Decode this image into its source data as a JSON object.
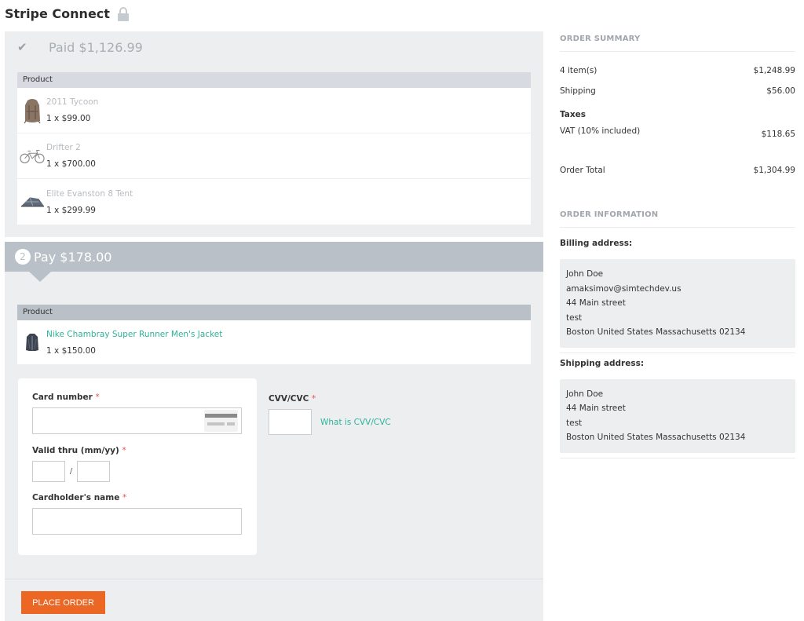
{
  "page": {
    "title": "Stripe Connect",
    "title_icon": "lock-icon"
  },
  "paid_section": {
    "icon": "check-icon",
    "title": "Paid $1,126.99",
    "product_header": "Product",
    "products": [
      {
        "name": "2011 Tycoon",
        "qty_price": "1 x $99.00",
        "thumb": "backpack"
      },
      {
        "name": "Drifter 2",
        "qty_price": "1 x $700.00",
        "thumb": "bicycle"
      },
      {
        "name": "Elite Evanston 8 Tent",
        "qty_price": "1 x $299.99",
        "thumb": "tent"
      }
    ]
  },
  "pay_section": {
    "step": "2",
    "title": "Pay $178.00",
    "product_header": "Product",
    "products": [
      {
        "name": "Nike Chambray Super Runner Men's Jacket",
        "qty_price": "1 x $150.00",
        "thumb": "jacket"
      }
    ]
  },
  "payment_form": {
    "card_number_label": "Card number",
    "card_number_value": "",
    "valid_thru_label": "Valid thru (mm/yy)",
    "month_value": "",
    "year_value": "",
    "separator": "/",
    "cardholder_label": "Cardholder's name",
    "cardholder_value": "",
    "cvv_label": "CVV/CVC",
    "cvv_value": "",
    "cvv_help_link": "What is CVV/CVC",
    "required_mark": "*"
  },
  "actions": {
    "place_order": "PLACE ORDER"
  },
  "order_summary": {
    "title": "ORDER SUMMARY",
    "items_label": "4 item(s)",
    "items_value": "$1,248.99",
    "shipping_label": "Shipping",
    "shipping_value": "$56.00",
    "taxes_label": "Taxes",
    "vat_label": "VAT (10% included)",
    "vat_value": "$118.65",
    "total_label": "Order Total",
    "total_value": "$1,304.99"
  },
  "order_information": {
    "title": "ORDER INFORMATION",
    "billing_title": "Billing address:",
    "billing_lines": [
      "John Doe",
      "amaksimov@simtechdev.us",
      "44 Main street",
      "test",
      "Boston United States Massachusetts 02134"
    ],
    "shipping_title": "Shipping address:",
    "shipping_lines": [
      "John Doe",
      "44 Main street",
      "test",
      "Boston United States Massachusetts 02134"
    ]
  },
  "colors": {
    "accent_link": "#2bb39a",
    "place_order_button": "#ec6624",
    "required": "#e5534b",
    "pay_header": "#b9c0c7",
    "panel_bg": "#edeef0"
  }
}
